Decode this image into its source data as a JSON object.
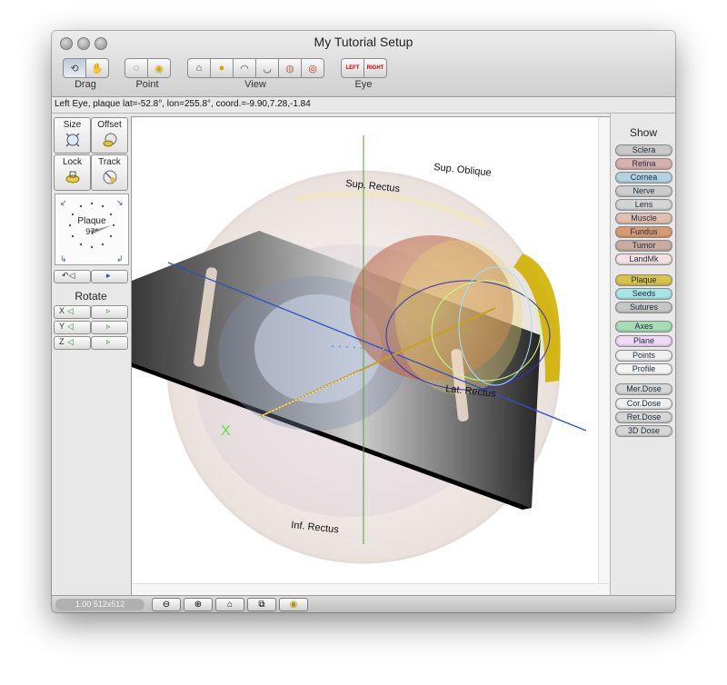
{
  "window": {
    "title": "My Tutorial Setup"
  },
  "toolbar": {
    "drag_label": "Drag",
    "point_label": "Point",
    "view_label": "View",
    "eye_label": "Eye",
    "eye_left": "LEFT",
    "eye_right": "RIGHT"
  },
  "status": {
    "text": "Left Eye, plaque lat=-52.8°, lon=255.8°, coord.=-9.90,7.28,-1.84"
  },
  "left_panel": {
    "size_label": "Size",
    "offset_label": "Offset",
    "lock_label": "Lock",
    "track_label": "Track",
    "dial_label": "Plaque",
    "dial_value": "97°",
    "rotate_label": "Rotate",
    "x_label": "X",
    "y_label": "Y",
    "z_label": "Z"
  },
  "viewport": {
    "labels": {
      "sup_oblique": "Sup. Oblique",
      "sup_rectus": "Sup. Rectus",
      "lat_rectus": "Lat. Rectus",
      "inf_rectus": "Inf. Rectus",
      "x_axis": "X"
    }
  },
  "right_panel": {
    "title": "Show",
    "items": [
      {
        "label": "Sclera",
        "color": "#c9c9c9"
      },
      {
        "label": "Retina",
        "color": "#d9b0ac"
      },
      {
        "label": "Cornea",
        "color": "#b2d4e0"
      },
      {
        "label": "Nerve",
        "color": "#cdcdcd"
      },
      {
        "label": "Lens",
        "color": "#d4d4d4"
      },
      {
        "label": "Muscle",
        "color": "#e0c0b0"
      },
      {
        "label": "Fundus",
        "color": "#d89a70"
      },
      {
        "label": "Tumor",
        "color": "#c8aca0"
      },
      {
        "label": "LandMk",
        "color": "#f4e2e2"
      },
      {
        "label": "Plaque",
        "color": "#d8c24a"
      },
      {
        "label": "Seeds",
        "color": "#a6e6e6"
      },
      {
        "label": "Sutures",
        "color": "#c6c6c6"
      },
      {
        "label": "Axes",
        "color": "#a6dcb6"
      },
      {
        "label": "Plane",
        "color": "#f0d8f8"
      },
      {
        "label": "Points",
        "color": "#f0f0f0"
      },
      {
        "label": "Profile",
        "color": "#f4f4f4"
      },
      {
        "label": "Mer.Dose",
        "color": "#d6d6d6"
      },
      {
        "label": "Cor.Dose",
        "color": "#f0f0f0"
      },
      {
        "label": "Ret.Dose",
        "color": "#d6d6d6"
      },
      {
        "label": "3D Dose",
        "color": "#d6d6d6"
      }
    ]
  },
  "bottom_bar": {
    "zoom_text": "1.00 512x512"
  }
}
